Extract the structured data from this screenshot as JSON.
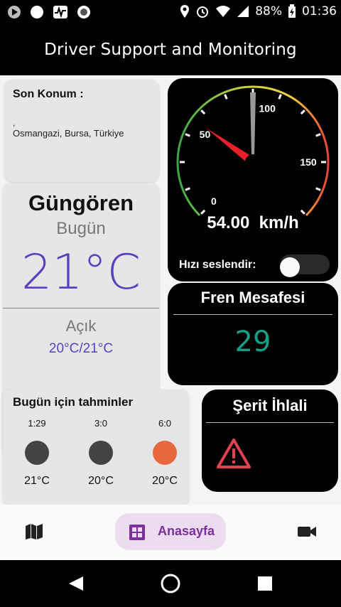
{
  "status_bar": {
    "battery": "88%",
    "time": "01:36"
  },
  "app_bar": {
    "title": "Driver Support and Monitoring"
  },
  "location": {
    "title": "Son Konum :",
    "line1": ",",
    "address": "Osmangazi, Bursa, Türkiye"
  },
  "weather": {
    "city": "Güngören",
    "day": "Bugün",
    "temp": "21°C",
    "condition": "Açık",
    "range": "20°C/21°C"
  },
  "forecast": {
    "title": "Bugün için tahminler",
    "items": [
      {
        "time": "1:29",
        "temp": "21°C",
        "dot_color": "#444444"
      },
      {
        "time": "3:0",
        "temp": "20°C",
        "dot_color": "#444444"
      },
      {
        "time": "6:0",
        "temp": "20°C",
        "dot_color": "#e8683e"
      }
    ]
  },
  "speedometer": {
    "value_kmh": 54,
    "readout": "54.00  km/h",
    "tick_labels": [
      "0",
      "50",
      "100",
      "150"
    ],
    "speak_label": "Hızı seslendir:",
    "speak_enabled": false
  },
  "brake_distance": {
    "title": "Fren Mesafesi",
    "value": "29"
  },
  "lane_violation": {
    "title": "Şerit İhlali"
  },
  "bottom_nav": {
    "home_label": "Anasayfa"
  },
  "colors": {
    "accent_purple": "#5b3fc0",
    "brake_value": "#13a086",
    "warning_red": "#e0424f",
    "nav_selected_bg": "#ecdcf0",
    "nav_selected_fg": "#7b2f9a"
  }
}
